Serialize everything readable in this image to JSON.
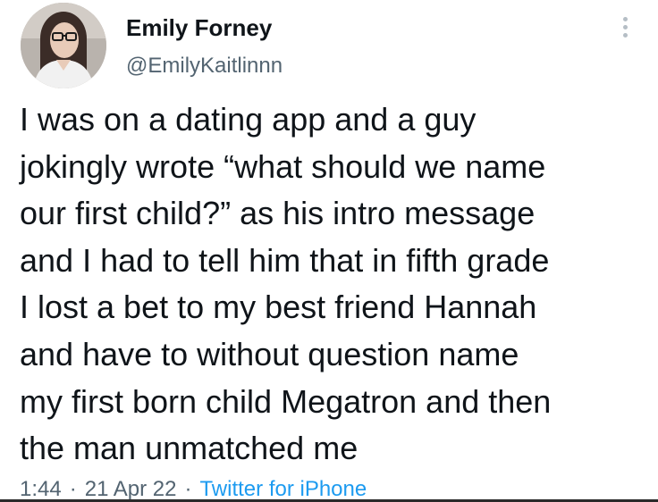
{
  "author": {
    "display_name": "Emily Forney",
    "handle": "@EmilyKaitlinnn",
    "avatar_icon": "profile-photo"
  },
  "more_icon": "more-vertical-icon",
  "tweet": {
    "lines": [
      "I was on a dating app and a guy",
      "jokingly wrote “what should we name",
      "our first child?” as his intro message",
      "and I had to tell him that in fifth grade",
      "I lost a bet to my best friend Hannah",
      "and have to without question name",
      "my first born child Megatron and then",
      "the man unmatched me"
    ]
  },
  "meta": {
    "time": "1:44",
    "separator": "·",
    "date": "21 Apr 22",
    "source": "Twitter for iPhone"
  },
  "colors": {
    "text": "#0f1419",
    "secondary": "#536471",
    "link": "#1d9bf0"
  }
}
